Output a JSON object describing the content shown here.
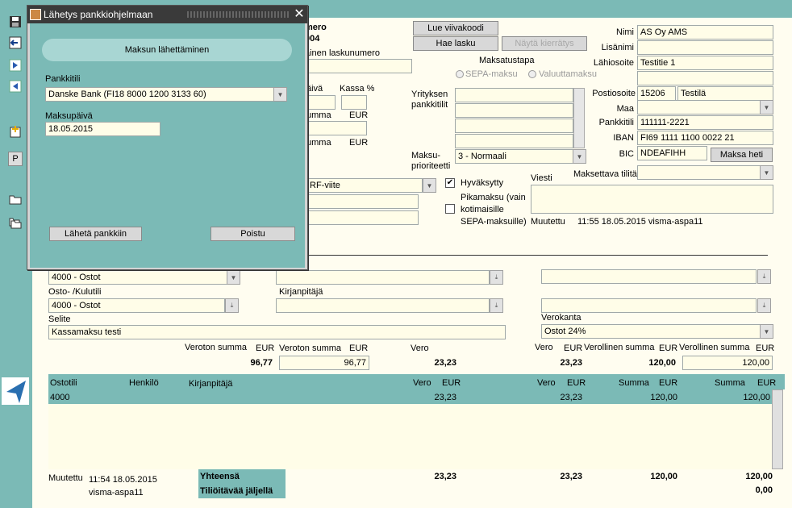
{
  "dialog": {
    "title": "Lähetys pankkiohjelmaan",
    "section_title": "Maksun lähettäminen",
    "account_label": "Pankkitili",
    "account_value": "Danske Bank (FI18 8000 1200 3133 60)",
    "date_label": "Maksupäivä",
    "date_value": "18.05.2015",
    "send_button": "Lähetä pankkiin",
    "exit_button": "Poistu",
    "close_icon": "close-icon"
  },
  "header": {
    "numero_label": "mero",
    "numero_value": "004",
    "ext_invoice_label": "äinen laskunumero",
    "paiva_label": "äivä",
    "kassa_label": "Kassa %",
    "summa_label1": "umma",
    "eur1": "EUR",
    "summa_label2": "umma",
    "eur2": "EUR",
    "reference_type": "RF-viite",
    "btn_read_barcode": "Lue viivakoodi",
    "btn_fetch_invoice": "Hae lasku",
    "btn_show_circulation": "Näytä kierrätys",
    "payment_method_label": "Maksatustapa",
    "sepa_label": "SEPA-maksu",
    "foreign_label": "Valuuttamaksu",
    "company_accounts_label1": "Yrityksen",
    "company_accounts_label2": "pankkitilit",
    "priority_label1": "Maksu-",
    "priority_label2": "prioriteetti",
    "priority_value": "3 - Normaali",
    "approved_label": "Hyväksytty",
    "express_label1": "Pikamaksu (vain",
    "express_label2": "kotimaisille",
    "express_label3": "SEPA-maksuille)",
    "message_label": "Viesti",
    "modified_label": "Muutettu",
    "modified_value": "11:55 18.05.2015 visma-aspa11",
    "payable_account_label": "Maksettava tilitä"
  },
  "supplier": {
    "name_label": "Nimi",
    "name_value": "AS Oy AMS",
    "extra_label": "Lisänimi",
    "street_label": "Lähiosoite",
    "street_value": "Testitie 1",
    "postal_label": "Postiosoite",
    "postal_code": "15206",
    "city": "Testilä",
    "country_label": "Maa",
    "bank_account_label": "Pankkitili",
    "bank_account_value": "111111-2221",
    "iban_label": "IBAN",
    "iban_value": "FI69 1111 1100 0022 21",
    "bic_label": "BIC",
    "bic_value": "NDEAFIHH",
    "pay_now_button": "Maksa heti"
  },
  "posting": {
    "account_value": "4000 - Ostot",
    "cost_account_label": "Osto- /Kulutili",
    "cost_account_value": "4000 - Ostot",
    "ledger_label": "Kirjanpitäjä",
    "description_label": "Selite",
    "description_value": "Kassamaksu testi",
    "vat_label": "Verokanta",
    "vat_value": "Ostot 24%",
    "net_label1": "Veroton summa",
    "net_eur1": "EUR",
    "net_label2": "Veroton summa",
    "net_eur2": "EUR",
    "net_value1": "96,77",
    "net_value2": "96,77",
    "tax_label1": "Vero",
    "tax_value1": "23,23",
    "tax_label2": "Vero",
    "tax_eur2": "EUR",
    "tax_value2": "23,23",
    "gross_label1": "Verollinen summa",
    "gross_eur1": "EUR",
    "gross_value1": "120,00",
    "gross_label2": "Verollinen summa",
    "gross_eur2": "EUR",
    "gross_value2": "120,00"
  },
  "table": {
    "headers": {
      "account": "Ostotili",
      "person": "Henkilö",
      "ledger": "Kirjanpitäjä",
      "tax1": "Vero",
      "eur1": "EUR",
      "tax2": "Vero",
      "eur2": "EUR",
      "sum1": "Summa",
      "eur3": "EUR",
      "sum2": "Summa",
      "eur4": "EUR"
    },
    "rows": [
      {
        "account": "4000",
        "tax1": "23,23",
        "tax2": "23,23",
        "sum1": "120,00",
        "sum2": "120,00"
      }
    ]
  },
  "footer": {
    "modified_label": "Muutettu",
    "modified_time": "11:54 18.05.2015",
    "modified_user": "visma-aspa11",
    "total_label": "Yhteensä",
    "remaining_label": "Tiliöitävää jäljellä",
    "total_tax1": "23,23",
    "total_tax2": "23,23",
    "total_sum1": "120,00",
    "total_sum2": "120,00",
    "remaining_value": "0,00"
  },
  "toolbar": {
    "p_label": "P"
  }
}
